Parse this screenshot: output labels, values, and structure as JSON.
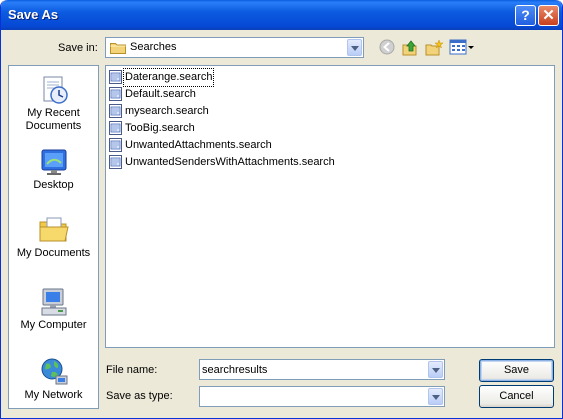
{
  "window": {
    "title": "Save As"
  },
  "toolbar": {
    "save_in_label": "Save in:",
    "current_folder": "Searches"
  },
  "places": [
    {
      "label": "My Recent Documents",
      "icon": "recent-documents-icon"
    },
    {
      "label": "Desktop",
      "icon": "desktop-icon"
    },
    {
      "label": "My Documents",
      "icon": "my-documents-icon"
    },
    {
      "label": "My Computer",
      "icon": "my-computer-icon"
    },
    {
      "label": "My Network",
      "icon": "my-network-icon"
    }
  ],
  "files": [
    "Daterange.search",
    "Default.search",
    "mysearch.search",
    "TooBig.search",
    "UnwantedAttachments.search",
    "UnwantedSendersWithAttachments.search"
  ],
  "form": {
    "file_name_label": "File name:",
    "file_name_value": "searchresults",
    "save_as_type_label": "Save as type:",
    "save_as_type_value": ""
  },
  "buttons": {
    "save": "Save",
    "cancel": "Cancel"
  },
  "colors": {
    "titlebar": "#0548d4",
    "dialog_bg": "#ece9d8",
    "border": "#7f9db9"
  }
}
